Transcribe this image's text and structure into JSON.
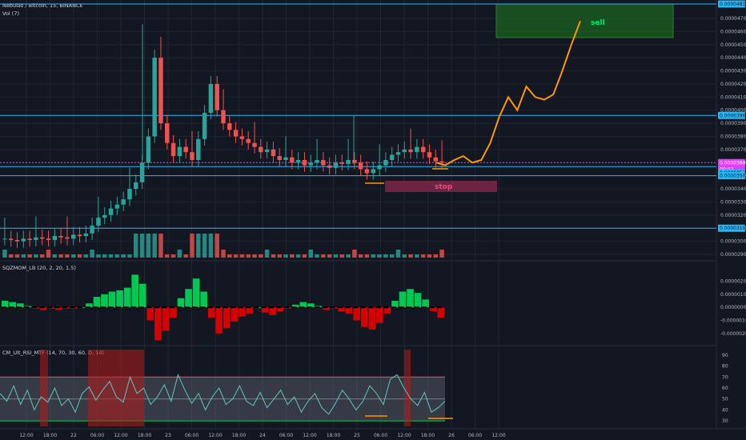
{
  "header": {
    "symbol": "Nebulas / Bitcoin, 15, BINANCE",
    "vol_label": "Vol (7)"
  },
  "colors": {
    "background": "#131722",
    "grid": "#1f2430",
    "up": "#26a69a",
    "down": "#ef5350",
    "hline": "#29b6f6",
    "magenta": "#e040fb",
    "projection": "#ff9800",
    "sell_zone": "#1b5e20",
    "sell_text": "#00e676",
    "stop_zone": "#7b2748",
    "stop_text": "#ff4081",
    "mom_up": "#00c853",
    "mom_down": "#d50000",
    "rsi_line": "#5ec6c0",
    "rsi_band": "#787b86"
  },
  "chart_data": [
    {
      "type": "candlestick",
      "title": "Nebulas / Bitcoin, 15, BINANCE",
      "ylim": [
        2.85e-05,
        4.85e-05
      ],
      "y_ticks": [
        "0.0000470",
        "0.0000460",
        "0.0000450",
        "0.0000440",
        "0.0000430",
        "0.0000420",
        "0.0000410",
        "0.0000400",
        "0.0000390",
        "0.0000380",
        "0.0000370",
        "0.0000360",
        "0.0000350",
        "0.0000340",
        "0.0000330",
        "0.0000320",
        "0.0000310",
        "0.0000300",
        "0.0000290"
      ],
      "x_ticks": [
        "12:00",
        "18:00",
        "22",
        "06:00",
        "12:00",
        "18:00",
        "23",
        "06:00",
        "12:00",
        "18:00",
        "24",
        "06:00",
        "12:00",
        "18:00",
        "25",
        "06:00",
        "12:00",
        "18:00",
        "26",
        "06:00",
        "12:00"
      ],
      "price_tags": [
        "0.0000481",
        "0.0000396",
        "0.0000360",
        "00:02",
        "0.0000357",
        "0.0000350",
        "0.0000310"
      ],
      "horizontal_levels": [
        4.81e-05,
        3.96e-05,
        3.57e-05,
        3.5e-05,
        3.1e-05
      ],
      "current_price": 3.6e-05,
      "close_series": [
        3.02e-05,
        3.01e-05,
        3e-05,
        3.02e-05,
        3.01e-05,
        3.03e-05,
        3.02e-05,
        3.01e-05,
        3.04e-05,
        3.03e-05,
        3.02e-05,
        3.05e-05,
        3.04e-05,
        3.06e-05,
        3.12e-05,
        3.18e-05,
        3.2e-05,
        3.25e-05,
        3.28e-05,
        3.32e-05,
        3.4e-05,
        3.45e-05,
        3.6e-05,
        3.8e-05,
        4.4e-05,
        3.9e-05,
        3.75e-05,
        3.65e-05,
        3.72e-05,
        3.68e-05,
        3.62e-05,
        3.78e-05,
        3.98e-05,
        4.2e-05,
        4e-05,
        3.9e-05,
        3.85e-05,
        3.8e-05,
        3.78e-05,
        3.75e-05,
        3.72e-05,
        3.68e-05,
        3.7e-05,
        3.65e-05,
        3.62e-05,
        3.64e-05,
        3.6e-05,
        3.62e-05,
        3.58e-05,
        3.6e-05,
        3.62e-05,
        3.58e-05,
        3.56e-05,
        3.6e-05,
        3.59e-05,
        3.62e-05,
        3.6e-05,
        3.55e-05,
        3.52e-05,
        3.55e-05,
        3.58e-05,
        3.62e-05,
        3.66e-05,
        3.68e-05,
        3.7e-05,
        3.68e-05,
        3.72e-05,
        3.68e-05,
        3.64e-05,
        3.61e-05,
        3.6e-05
      ],
      "annotations": [
        "sell",
        "stop"
      ],
      "projection_path": [
        3.6e-05,
        3.58e-05,
        3.62e-05,
        3.65e-05,
        3.6e-05,
        3.62e-05,
        3.75e-05,
        3.95e-05,
        4.1e-05,
        4e-05,
        4.18e-05,
        4.1e-05,
        4.08e-05,
        4.12e-05,
        4.3e-05,
        4.5e-05,
        4.68e-05
      ]
    },
    {
      "type": "bar",
      "title": "SQZMOM_LB (20, 2, 20, 1.5)",
      "y_ticks": [
        "0.0000020",
        "0.0000010",
        "0.0000000",
        "-0.0000010",
        "-0.0000020"
      ],
      "ylim": [
        -2.5e-06,
        2.7e-06
      ],
      "values": [
        5e-07,
        4e-07,
        3e-07,
        1e-07,
        -1e-07,
        -2e-07,
        -1e-07,
        -2e-07,
        -1e-07,
        -1e-07,
        0.0,
        3e-07,
        8e-07,
        1e-06,
        1.2e-06,
        1.3e-06,
        1.5e-06,
        2.5e-06,
        1.8e-06,
        -1e-06,
        -2.5e-06,
        -1.8e-06,
        -8e-07,
        7e-07,
        1.4e-06,
        2.2e-06,
        1.2e-06,
        -8e-07,
        -2e-06,
        -1.6e-06,
        -1.1e-06,
        -7e-07,
        -5e-07,
        0.0,
        -4e-07,
        -6e-07,
        -3e-07,
        -1e-07,
        2e-07,
        4e-07,
        3e-07,
        1e-07,
        -2e-07,
        -1e-07,
        -3e-07,
        -5e-07,
        -1e-06,
        -1.5e-06,
        -1.7e-06,
        -1.2e-06,
        -5e-07,
        5e-07,
        1.2e-06,
        1.4e-06,
        1.1e-06,
        6e-07,
        -3e-07,
        -8e-07
      ]
    },
    {
      "type": "line",
      "title": "CM_Ult_RSI_MTF (14, 70, 30, 60, D, 14)",
      "y_ticks": [
        "90",
        "80",
        "70",
        "60",
        "50",
        "40",
        "30"
      ],
      "ylim": [
        25,
        95
      ],
      "band": [
        30,
        70
      ],
      "midline": 50,
      "values": [
        55,
        48,
        62,
        45,
        58,
        40,
        52,
        47,
        60,
        44,
        50,
        38,
        55,
        61,
        49,
        58,
        66,
        52,
        47,
        70,
        55,
        60,
        45,
        52,
        63,
        48,
        72,
        58,
        46,
        55,
        40,
        52,
        60,
        45,
        50,
        62,
        48,
        44,
        56,
        42,
        50,
        58,
        45,
        52,
        38,
        48,
        55,
        42,
        36,
        46,
        58,
        50,
        40,
        48,
        62,
        55,
        45,
        68,
        72,
        60,
        50,
        44,
        56,
        38,
        42,
        48
      ]
    }
  ],
  "sqz_title": "SQZMOM_LB (20, 2, 20, 1.5)",
  "rsi_title": "CM_Ult_RSI_MTF (14, 70, 30, 60, D, 14)",
  "sell_label": "sell",
  "stop_label": "stop"
}
